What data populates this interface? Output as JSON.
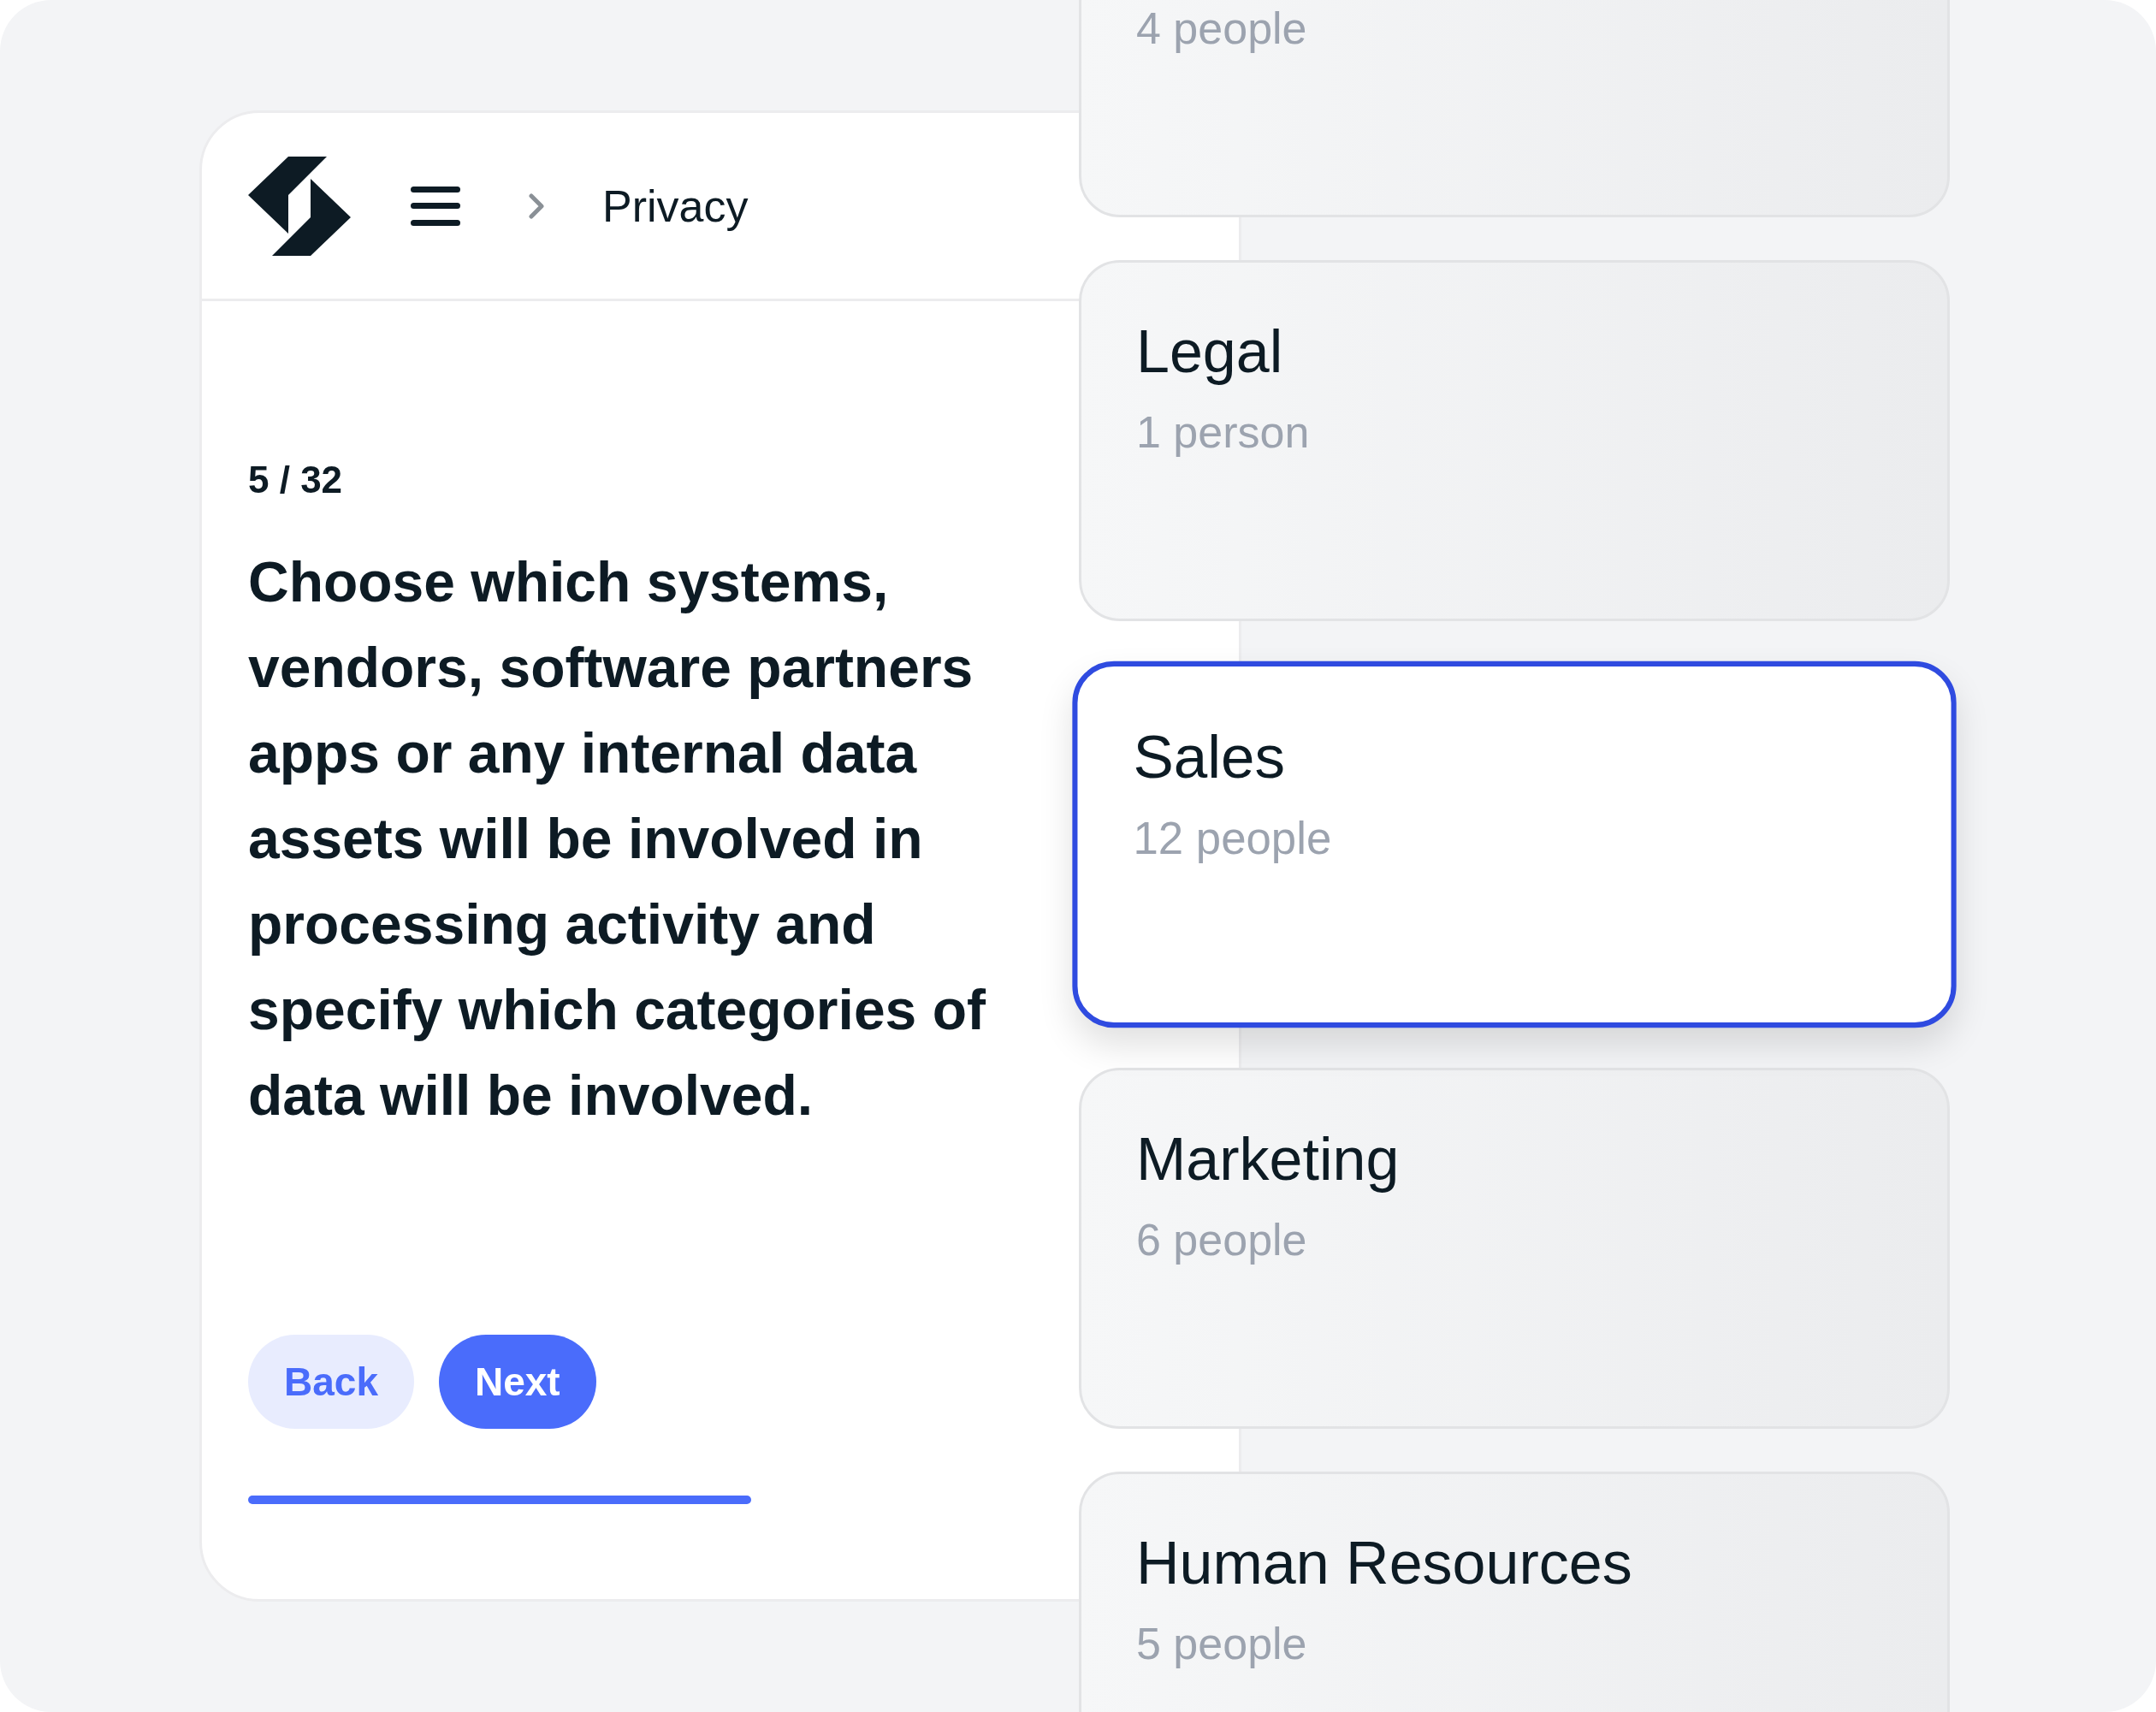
{
  "header": {
    "breadcrumb": "Privacy"
  },
  "step": "5 / 32",
  "question": "Choose which systems, vendors, software partners apps or any internal data assets will be involved in processing activity and specify which categories of data will be involved.",
  "buttons": [
    {
      "label": "Back",
      "kind": "secondary"
    },
    {
      "label": "Next",
      "kind": "primary"
    }
  ],
  "groups": [
    {
      "count": "4 people",
      "selected": false
    },
    {
      "name": "Legal",
      "count": "1 person",
      "selected": false
    },
    {
      "name": "Sales",
      "count": "12 people",
      "selected": true
    },
    {
      "name": "Marketing",
      "count": "6 people",
      "selected": false
    },
    {
      "name": "Human Resources",
      "count": "5 people",
      "selected": false
    }
  ]
}
